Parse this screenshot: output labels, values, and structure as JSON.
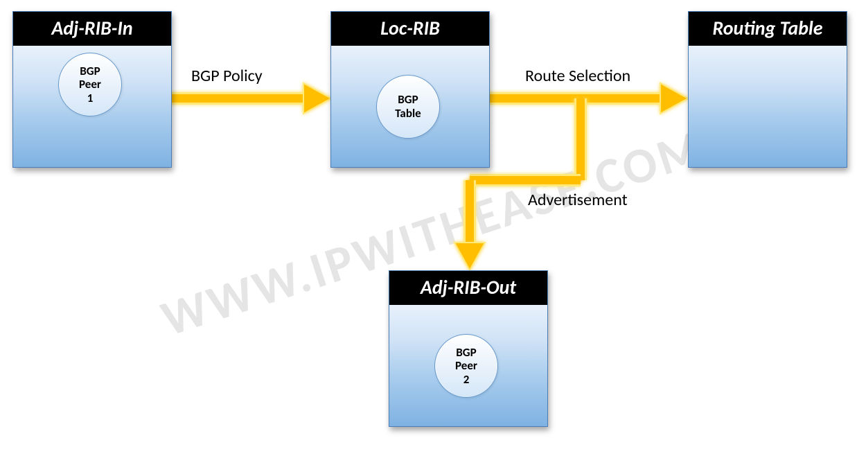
{
  "watermark": "WWW.IPWITHEASE.COM",
  "boxes": {
    "adjRibIn": {
      "title": "Adj-RIB-In",
      "circleLine1": "BGP",
      "circleLine2": "Peer",
      "circleLine3": "1"
    },
    "locRib": {
      "title": "Loc-RIB",
      "circleLine1": "BGP",
      "circleLine2": "Table"
    },
    "routingTable": {
      "title": "Routing Table"
    },
    "adjRibOut": {
      "title": "Adj-RIB-Out",
      "circleLine1": "BGP",
      "circleLine2": "Peer",
      "circleLine3": "2"
    }
  },
  "arrows": {
    "bgpPolicy": "BGP Policy",
    "routeSelection": "Route Selection",
    "advertisement": "Advertisement"
  },
  "colors": {
    "arrowFill": "#ffbf00",
    "arrowGlow": "#ffe97a",
    "headerBg": "#000000",
    "headerText": "#ffffff"
  }
}
